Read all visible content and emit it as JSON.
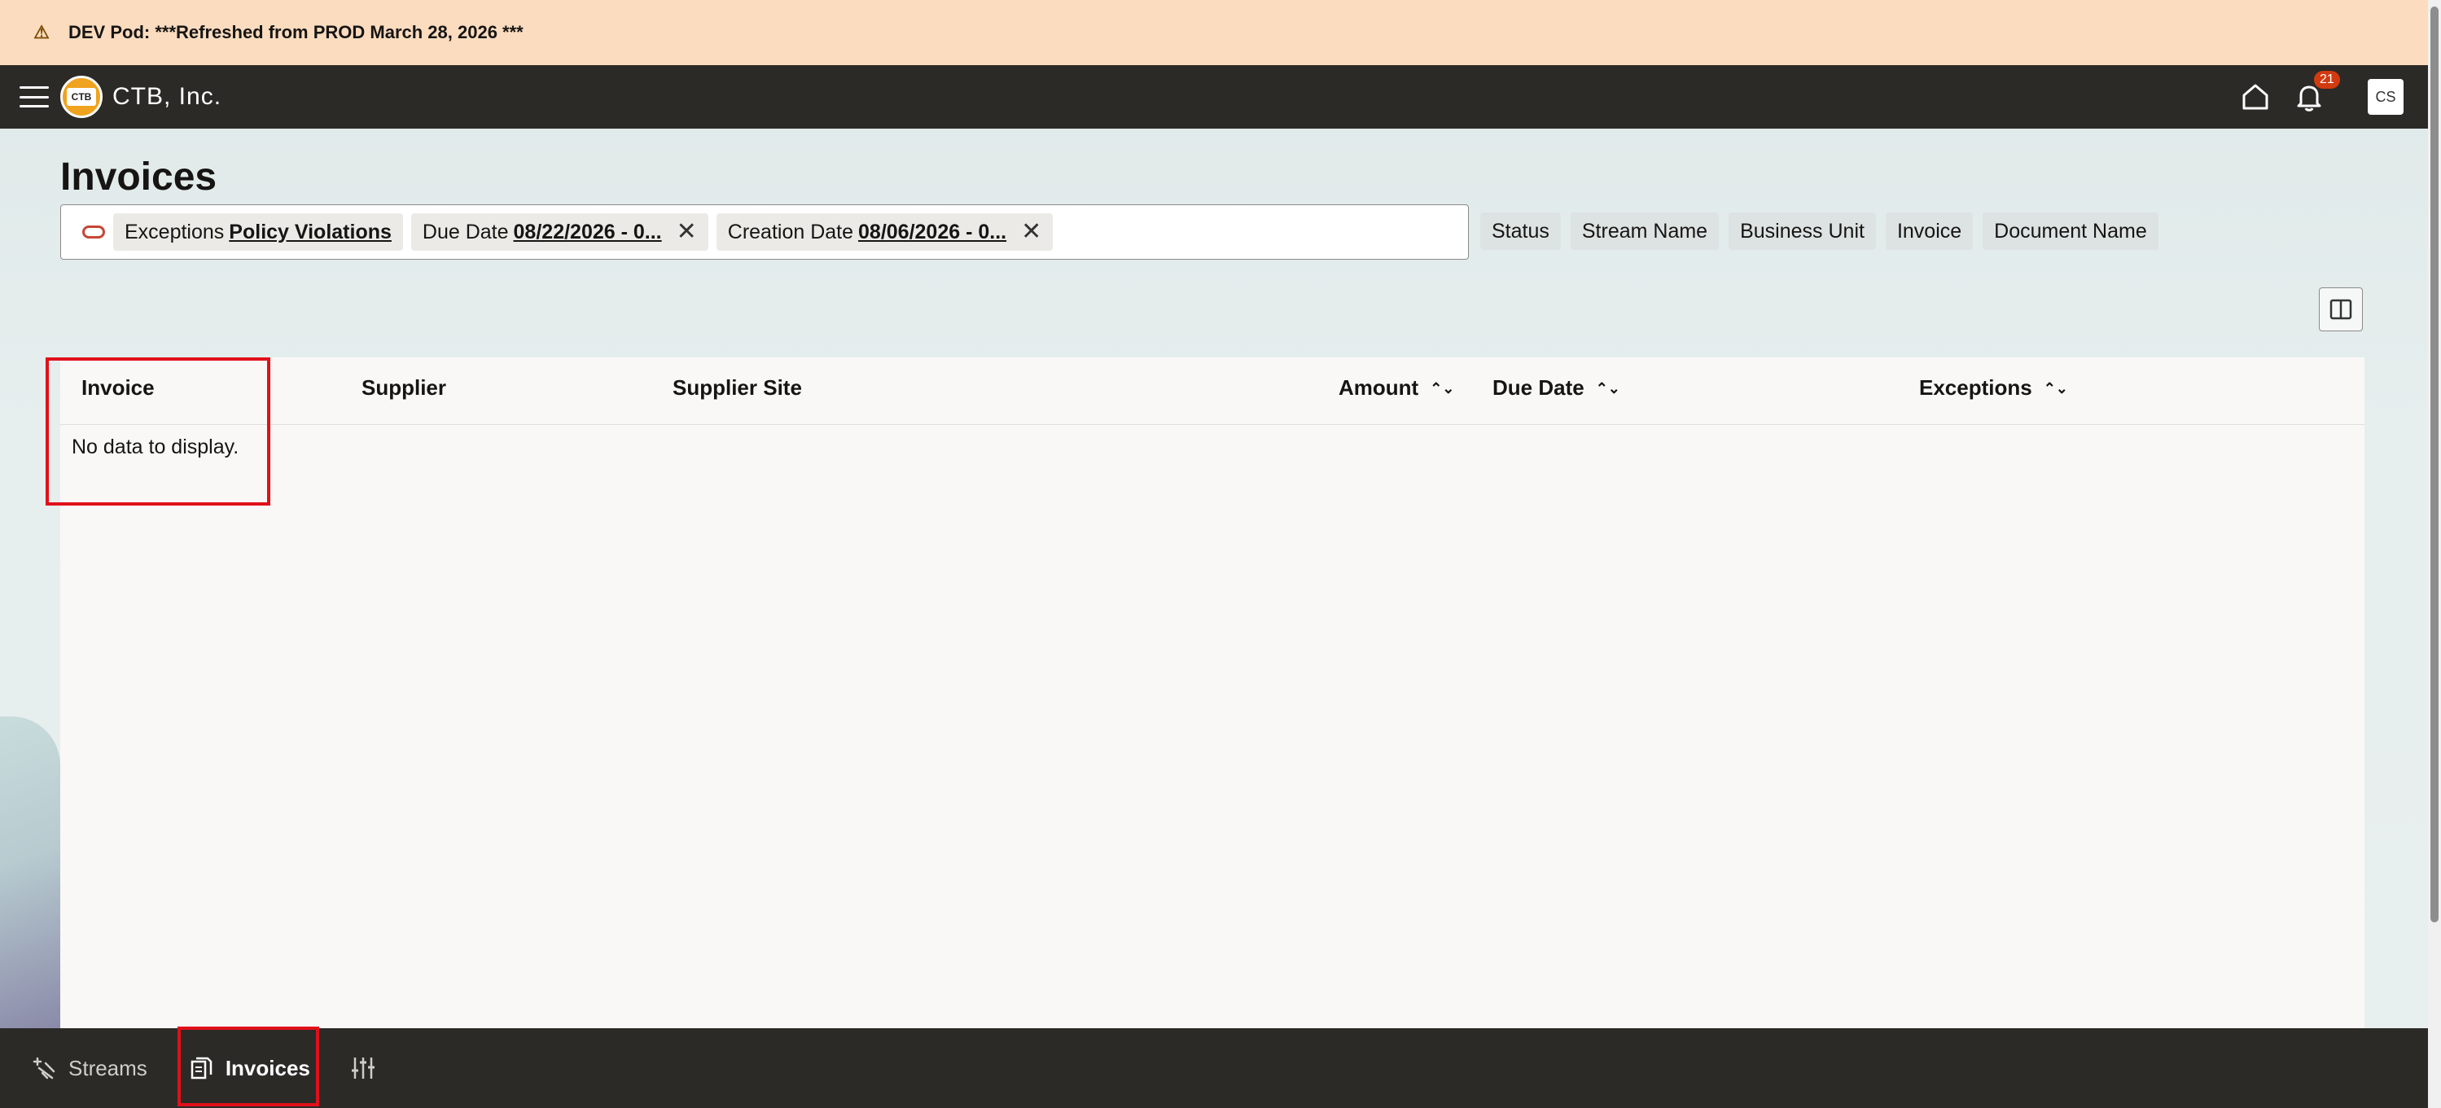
{
  "banner": {
    "icon": "warning-icon",
    "text": "DEV Pod: ***Refreshed from PROD March 28, 2026 ***"
  },
  "header": {
    "app_name": "CTB, Inc.",
    "logo_text": "CTB",
    "notification_count": "21",
    "avatar_initials": "CS"
  },
  "page": {
    "title": "Invoices"
  },
  "filters": {
    "chips": [
      {
        "label": "Exceptions",
        "value": "Policy Violations"
      },
      {
        "label": "Due Date",
        "value": "08/22/2026 - 0..."
      },
      {
        "label": "Creation Date",
        "value": "08/06/2026 - 0..."
      }
    ],
    "facets": [
      "Status",
      "Stream Name",
      "Business Unit",
      "Invoice",
      "Document Name"
    ]
  },
  "table": {
    "columns": [
      "Invoice",
      "Supplier",
      "Supplier Site",
      "Amount",
      "Due Date",
      "Exceptions"
    ],
    "empty_message": "No data to display."
  },
  "bottom_nav": {
    "streams": "Streams",
    "invoices": "Invoices"
  },
  "colors": {
    "accent_red": "#e0101a",
    "topbar": "#2b2a27",
    "banner": "#fbdcbf",
    "badge": "#d23a10"
  }
}
